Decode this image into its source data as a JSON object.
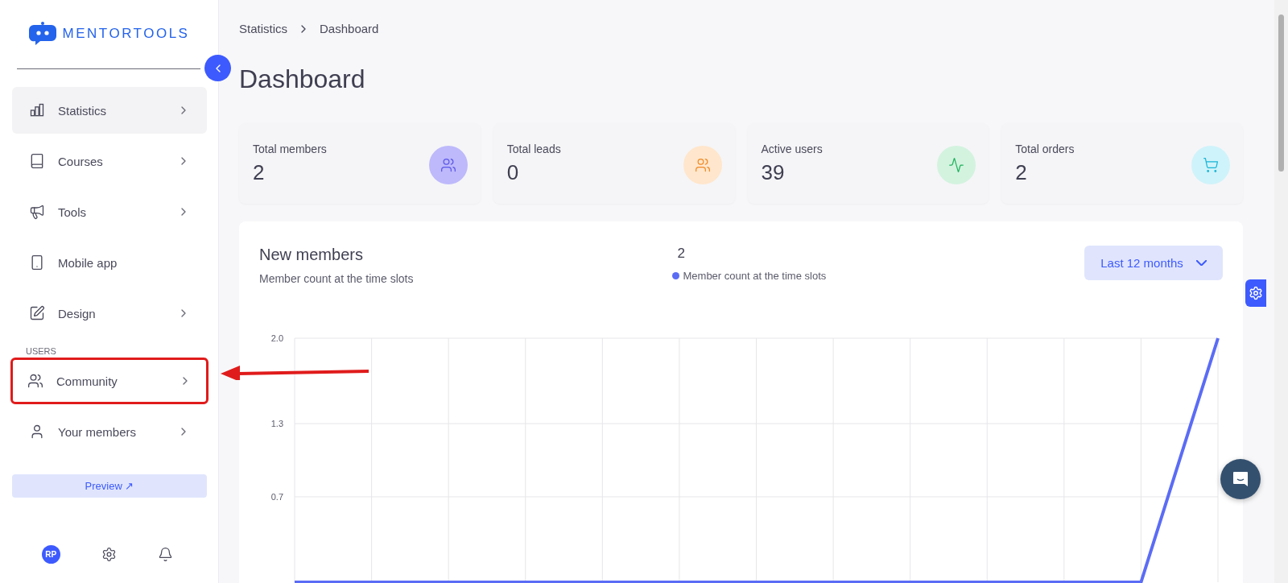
{
  "brand": {
    "name": "MENTORTOOLS"
  },
  "sidebar": {
    "items": [
      {
        "label": "Statistics",
        "selected": true,
        "chevron": true,
        "highlighted": false
      },
      {
        "label": "Courses",
        "selected": false,
        "chevron": true,
        "highlighted": false
      },
      {
        "label": "Tools",
        "selected": false,
        "chevron": true,
        "highlighted": false
      },
      {
        "label": "Mobile app",
        "selected": false,
        "chevron": false,
        "highlighted": false
      },
      {
        "label": "Design",
        "selected": false,
        "chevron": true,
        "highlighted": false
      }
    ],
    "section": "USERS",
    "user_items": [
      {
        "label": "Community",
        "selected": false,
        "chevron": true,
        "highlighted": true
      },
      {
        "label": "Your members",
        "selected": false,
        "chevron": true,
        "highlighted": false
      }
    ],
    "preview_button": "Preview ↗",
    "avatar": "RP"
  },
  "breadcrumb": [
    "Statistics",
    "Dashboard"
  ],
  "page_title": "Dashboard",
  "stats": [
    {
      "label": "Total members",
      "value": "2",
      "color": "#bdb9fb"
    },
    {
      "label": "Total leads",
      "value": "0",
      "color": "#ffe6cc"
    },
    {
      "label": "Active users",
      "value": "39",
      "color": "#d3f3df"
    },
    {
      "label": "Total orders",
      "value": "2",
      "color": "#cff3fa"
    }
  ],
  "new_members": {
    "title": "New members",
    "subtitle": "Member count at the time slots",
    "total": "2",
    "range": "Last 12 months",
    "chart_data": {
      "type": "line",
      "grid": true,
      "series": [
        {
          "name": "Member count at the time slots",
          "color": "#5b6cf5",
          "values": [
            0,
            0,
            0,
            0,
            0,
            0,
            0,
            0,
            0,
            0,
            0,
            0,
            2
          ]
        }
      ],
      "ylim": [
        0,
        2
      ],
      "yticks": [
        {
          "value": 0.7,
          "label": "0.7"
        },
        {
          "value": 1.3,
          "label": "1.3"
        },
        {
          "value": 2,
          "label": "2.0"
        }
      ]
    }
  }
}
